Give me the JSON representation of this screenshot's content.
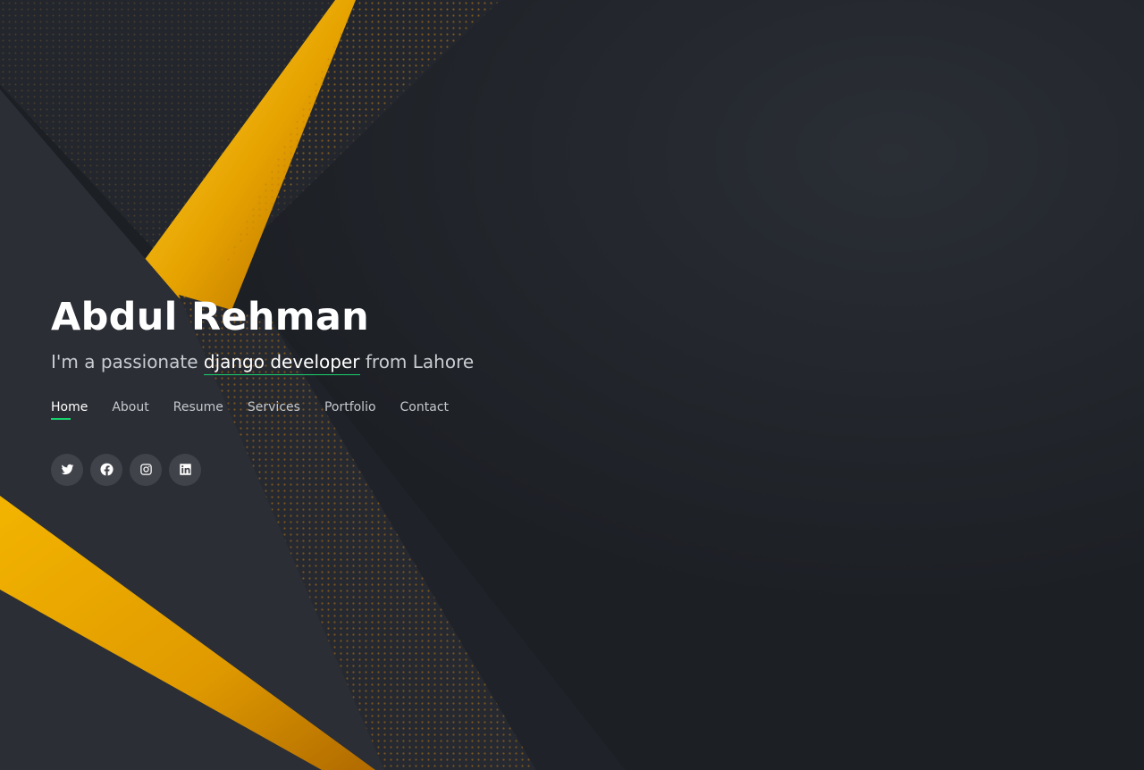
{
  "hero": {
    "name": "Abdul Rehman",
    "tagline_prefix": "I'm a passionate ",
    "tagline_typed": "django developer",
    "tagline_suffix": " from Lahore"
  },
  "nav": {
    "items": [
      {
        "label": "Home",
        "active": true
      },
      {
        "label": "About"
      },
      {
        "label": "Resume"
      },
      {
        "label": "Services"
      },
      {
        "label": "Portfolio"
      },
      {
        "label": "Contact"
      }
    ]
  },
  "social": [
    "twitter-icon",
    "facebook-icon",
    "instagram-icon",
    "linkedin-icon"
  ],
  "colors": {
    "accent": "#18d26e",
    "gold": "#f0a500",
    "background": "#1c1f24",
    "text": "#ffffff"
  }
}
